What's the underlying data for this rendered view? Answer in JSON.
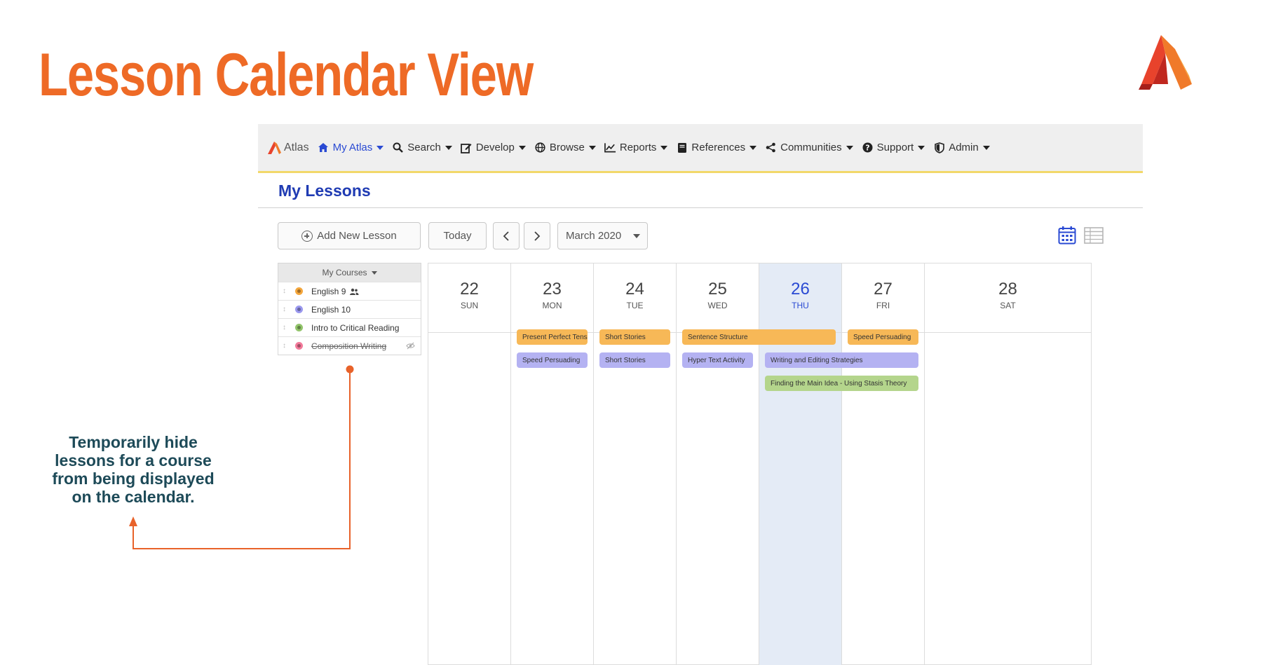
{
  "slide": {
    "title": "Lesson Calendar View",
    "annotation": "Temporarily hide lessons for a course from being displayed on the calendar."
  },
  "colors": {
    "title": "#ee6a26",
    "accent_blue": "#2a4ad3",
    "annotation": "#1d4a58",
    "event_orange": "#f7b857",
    "event_purple": "#b4b2f2",
    "event_green": "#b4d58c"
  },
  "nav": {
    "brand": "Atlas",
    "items": [
      {
        "label": "My Atlas",
        "icon": "home-icon"
      },
      {
        "label": "Search",
        "icon": "search-icon"
      },
      {
        "label": "Develop",
        "icon": "edit-icon"
      },
      {
        "label": "Browse",
        "icon": "globe-icon"
      },
      {
        "label": "Reports",
        "icon": "chart-icon"
      },
      {
        "label": "References",
        "icon": "book-icon"
      },
      {
        "label": "Communities",
        "icon": "share-icon"
      },
      {
        "label": "Support",
        "icon": "help-icon"
      },
      {
        "label": "Admin",
        "icon": "shield-icon"
      }
    ]
  },
  "page": {
    "title": "My Lessons"
  },
  "toolbar": {
    "add_label": "Add New Lesson",
    "today_label": "Today",
    "month_label": "March 2020"
  },
  "courses": {
    "header": "My Courses",
    "items": [
      {
        "name": "English 9",
        "color": "#f4a63c",
        "hidden": false,
        "shared": true
      },
      {
        "name": "English 10",
        "color": "#9a98ee",
        "hidden": false,
        "shared": false
      },
      {
        "name": "Intro to Critical Reading",
        "color": "#92c46a",
        "hidden": false,
        "shared": false
      },
      {
        "name": "Composition Writing",
        "color": "#f27a9a",
        "hidden": true,
        "shared": false
      }
    ]
  },
  "calendar": {
    "days": [
      {
        "num": "22",
        "name": "SUN",
        "today": false
      },
      {
        "num": "23",
        "name": "MON",
        "today": false
      },
      {
        "num": "24",
        "name": "TUE",
        "today": false
      },
      {
        "num": "25",
        "name": "WED",
        "today": false
      },
      {
        "num": "26",
        "name": "THU",
        "today": true
      },
      {
        "num": "27",
        "name": "FRI",
        "today": false
      },
      {
        "num": "28",
        "name": "SAT",
        "today": false
      }
    ],
    "events": [
      {
        "title": "Present Perfect Tense",
        "course": "English 9",
        "start_day": "23",
        "end_day": "23"
      },
      {
        "title": "Short Stories",
        "course": "English 9",
        "start_day": "24",
        "end_day": "24"
      },
      {
        "title": "Sentence Structure",
        "course": "English 9",
        "start_day": "25",
        "end_day": "26"
      },
      {
        "title": "Speed Persuading",
        "course": "English 9",
        "start_day": "27",
        "end_day": "27"
      },
      {
        "title": "Speed Persuading",
        "course": "English 10",
        "start_day": "23",
        "end_day": "23"
      },
      {
        "title": "Short Stories",
        "course": "English 10",
        "start_day": "24",
        "end_day": "24"
      },
      {
        "title": "Hyper Text Activity",
        "course": "English 10",
        "start_day": "25",
        "end_day": "25"
      },
      {
        "title": "Writing and Editing Strategies",
        "course": "English 10",
        "start_day": "26",
        "end_day": "27"
      },
      {
        "title": "Finding the Main Idea - Using Stasis Theory",
        "course": "Intro to Critical Reading",
        "start_day": "26",
        "end_day": "27"
      }
    ]
  }
}
